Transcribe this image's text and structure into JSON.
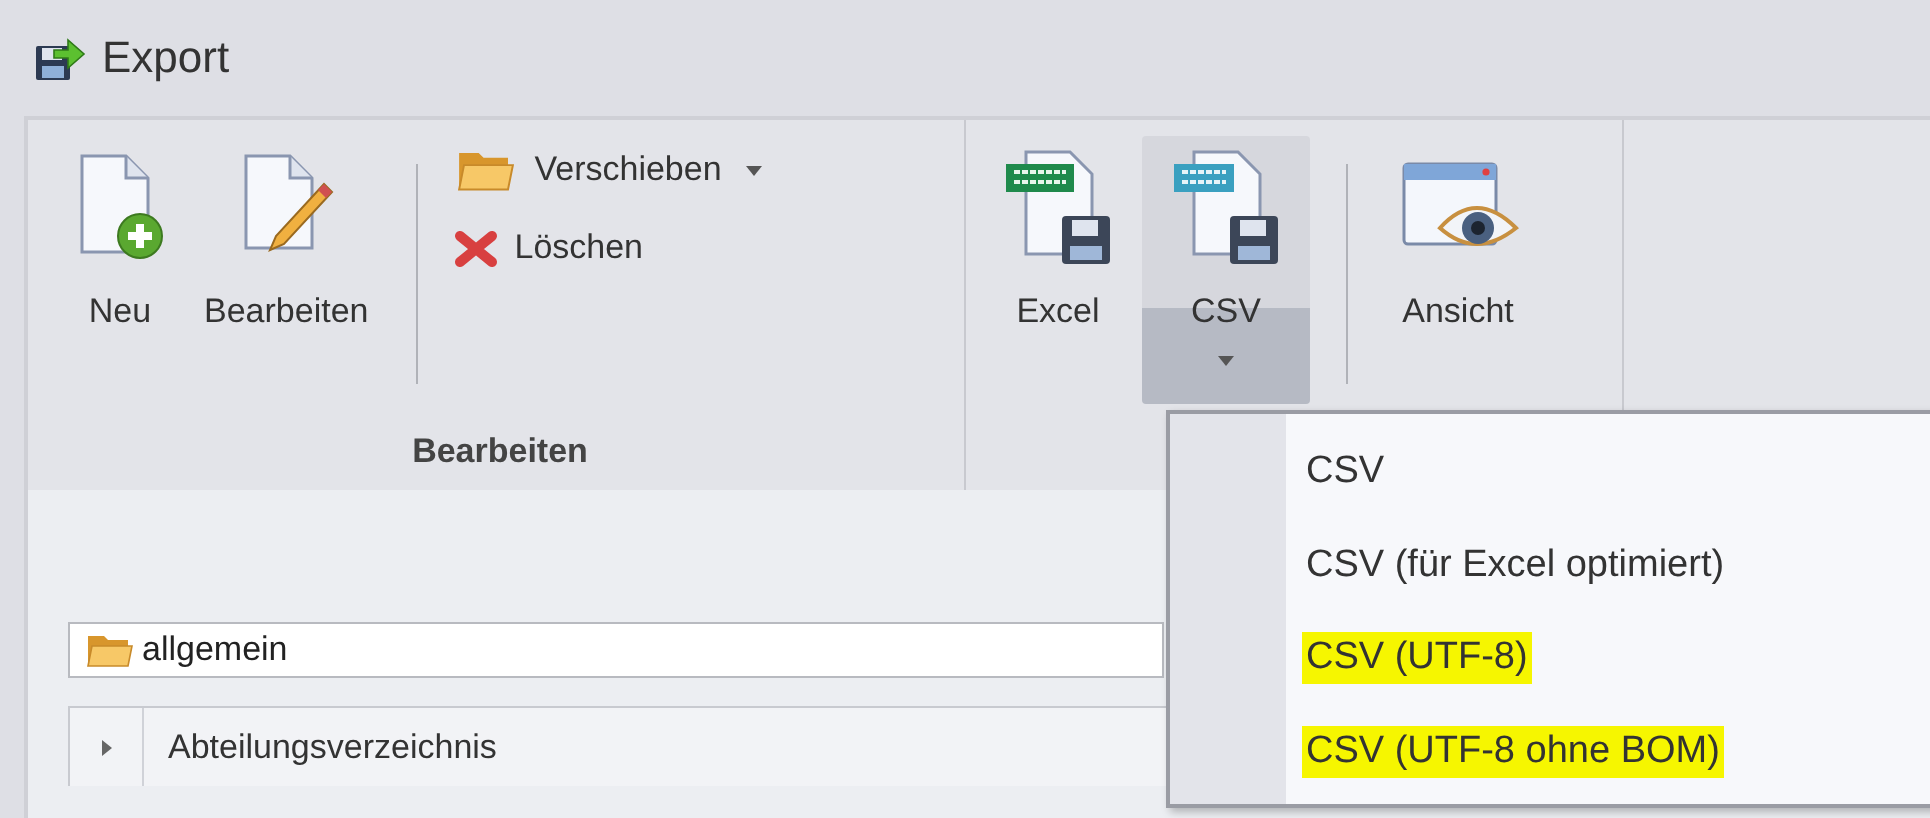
{
  "window": {
    "title": "Export"
  },
  "ribbon": {
    "groups": [
      {
        "label": "Bearbeiten",
        "items": [
          {
            "kind": "large",
            "label": "Neu",
            "pressed": false,
            "dropdown": false
          },
          {
            "kind": "large",
            "label": "Bearbeiten",
            "pressed": false,
            "dropdown": false
          },
          {
            "kind": "separator"
          },
          {
            "kind": "stack",
            "buttons": [
              {
                "label": "Verschieben",
                "dropdown": true
              },
              {
                "label": "Löschen",
                "dropdown": false
              }
            ]
          }
        ]
      },
      {
        "items": [
          {
            "kind": "large",
            "label": "Excel",
            "pressed": false,
            "dropdown": false
          },
          {
            "kind": "large",
            "label": "CSV",
            "pressed": true,
            "dropdown": true
          },
          {
            "kind": "separator"
          },
          {
            "kind": "large",
            "label": "Ansicht",
            "pressed": false,
            "dropdown": false
          }
        ]
      }
    ]
  },
  "breadcrumb": {
    "path": "allgemein"
  },
  "tree": {
    "rows": [
      {
        "label": "Abteilungsverzeichnis",
        "expanded": false
      }
    ]
  },
  "menu": {
    "items": [
      {
        "label": "CSV",
        "highlighted": false
      },
      {
        "label": "CSV (für Excel optimiert)",
        "highlighted": false
      },
      {
        "label": "CSV (UTF-8)",
        "highlighted": true
      },
      {
        "label": "CSV (UTF-8 ohne BOM)",
        "highlighted": true
      }
    ]
  }
}
